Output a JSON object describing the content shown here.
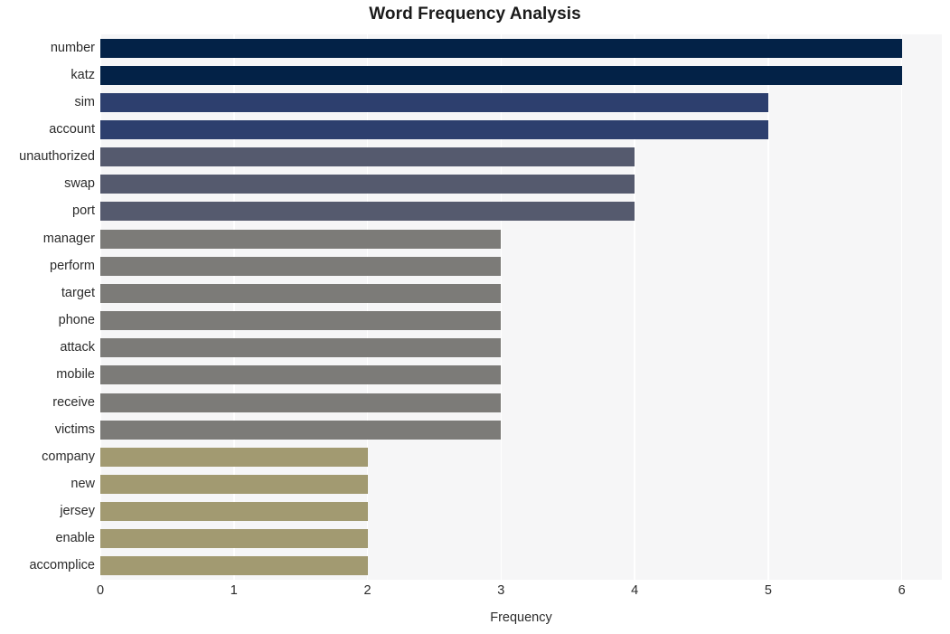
{
  "chart_data": {
    "type": "bar",
    "orientation": "horizontal",
    "title": "Word Frequency Analysis",
    "xlabel": "Frequency",
    "ylabel": "",
    "xlim": [
      0,
      6.3
    ],
    "xticks": [
      "0",
      "1",
      "2",
      "3",
      "4",
      "5",
      "6"
    ],
    "xtick_values": [
      0,
      1,
      2,
      3,
      4,
      5,
      6
    ],
    "grid": "vertical-white",
    "legend": "none",
    "categories": [
      "number",
      "katz",
      "sim",
      "account",
      "unauthorized",
      "swap",
      "port",
      "manager",
      "perform",
      "target",
      "phone",
      "attack",
      "mobile",
      "receive",
      "victims",
      "company",
      "new",
      "jersey",
      "enable",
      "accomplice"
    ],
    "values": [
      6,
      6,
      5,
      5,
      4,
      4,
      4,
      3,
      3,
      3,
      3,
      3,
      3,
      3,
      3,
      2,
      2,
      2,
      2,
      2
    ],
    "bar_colors": [
      "#032247",
      "#032247",
      "#2d3f6e",
      "#2d3f6e",
      "#555a6e",
      "#555a6e",
      "#555a6e",
      "#7c7b78",
      "#7c7b78",
      "#7c7b78",
      "#7c7b78",
      "#7c7b78",
      "#7c7b78",
      "#7c7b78",
      "#7c7b78",
      "#a29a71",
      "#a29a71",
      "#a29a71",
      "#a29a71",
      "#a29a71"
    ],
    "plot_background": "#f6f6f7",
    "figure_background": "#ffffff",
    "gridline_color": "#ffffff",
    "text_color": "#2b2b2b"
  }
}
